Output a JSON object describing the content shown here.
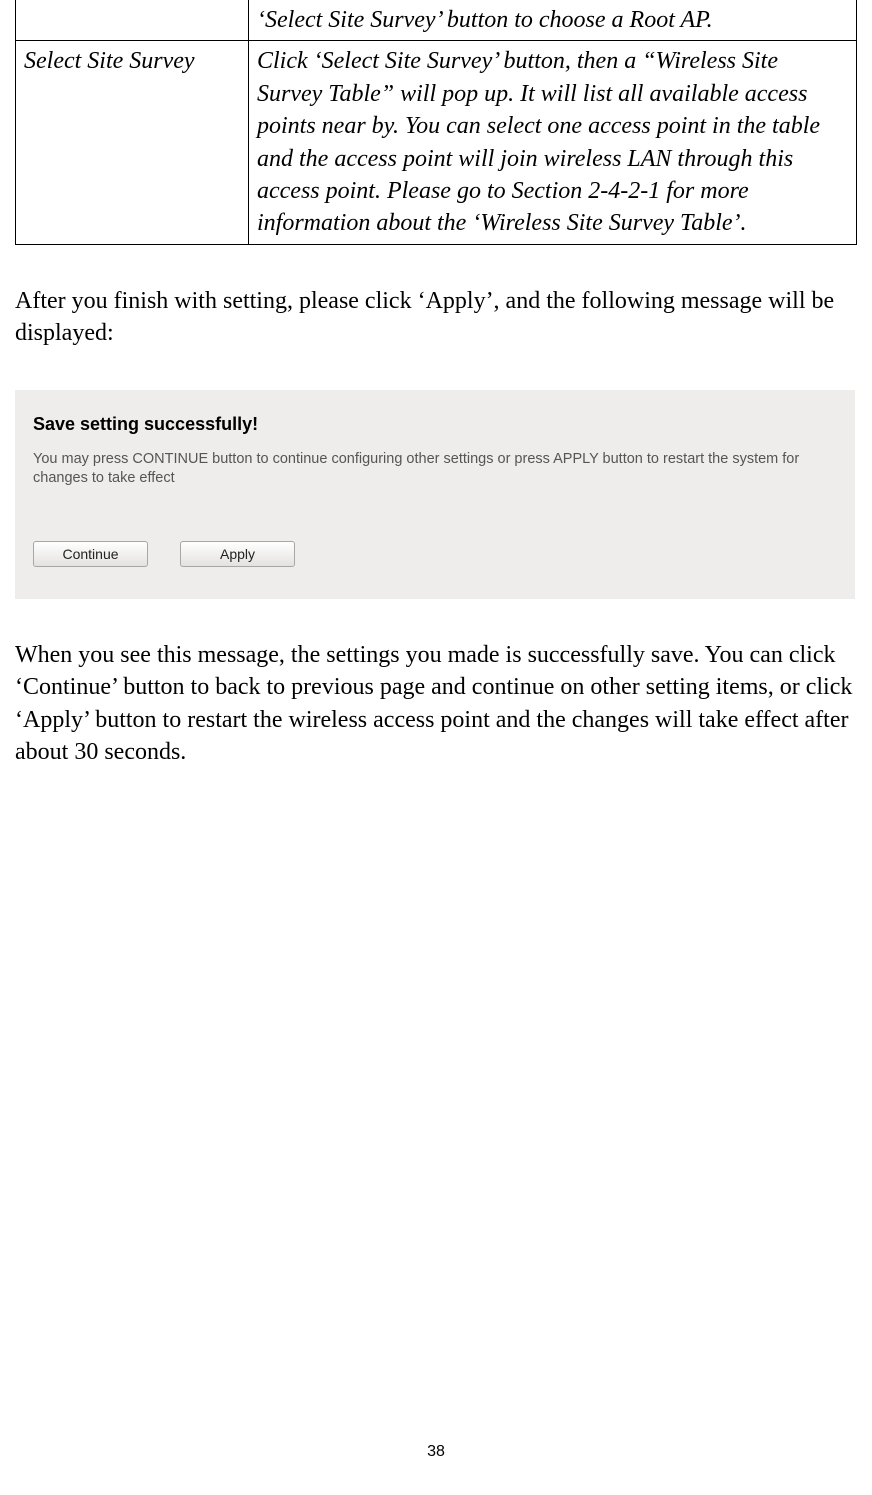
{
  "table": {
    "row1": {
      "left": "",
      "right": "‘Select Site Survey’ button to choose a Root AP."
    },
    "row2": {
      "left": "Select Site Survey",
      "right": "Click ‘Select Site Survey’ button, then a “Wireless Site Survey Table” will pop up. It will list all available access points near by. You can select one access point in the table and the access point will join wireless LAN through this access point. Please go to Section 2-4-2-1 for more information about the ‘Wireless Site Survey Table’."
    }
  },
  "para1": "After you finish with setting, please click ‘Apply’, and the following message will be displayed:",
  "screenshot": {
    "heading": "Save setting successfully!",
    "desc": "You may press CONTINUE button to continue configuring other settings or press APPLY button to restart the system for changes to take effect",
    "continue_label": "Continue",
    "apply_label": "Apply"
  },
  "para2": "When you see this message, the settings you made is successfully save. You can click ‘Continue’ button to back to previous page and continue on other setting items, or click ‘Apply’ button to restart the wireless access point and the changes will take effect after about 30 seconds.",
  "page_number": "38"
}
